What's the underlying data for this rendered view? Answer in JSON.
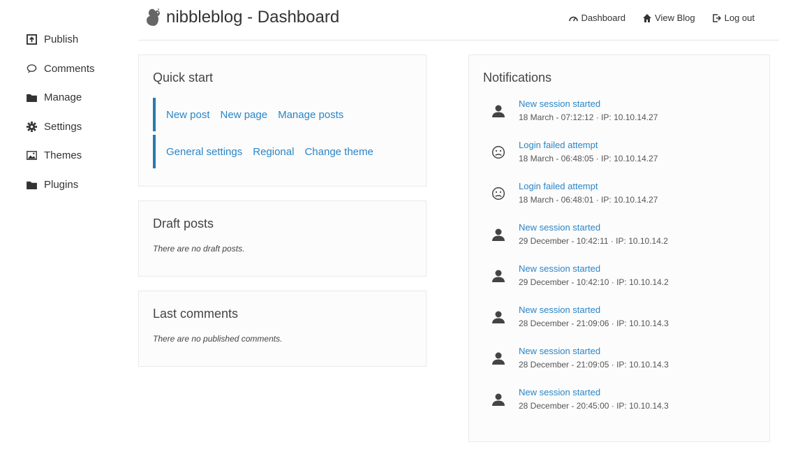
{
  "header": {
    "title": "nibbleblog - Dashboard",
    "nav": [
      {
        "label": "Dashboard",
        "icon": "dashboard-icon"
      },
      {
        "label": "View Blog",
        "icon": "home-icon"
      },
      {
        "label": "Log out",
        "icon": "logout-icon"
      }
    ]
  },
  "sidebar": {
    "items": [
      {
        "label": "Publish",
        "icon": "upload-icon"
      },
      {
        "label": "Comments",
        "icon": "comment-icon"
      },
      {
        "label": "Manage",
        "icon": "folder-icon"
      },
      {
        "label": "Settings",
        "icon": "gear-icon"
      },
      {
        "label": "Themes",
        "icon": "image-icon"
      },
      {
        "label": "Plugins",
        "icon": "folder-icon"
      }
    ]
  },
  "quick_start": {
    "title": "Quick start",
    "row1": [
      "New post",
      "New page",
      "Manage posts"
    ],
    "row2": [
      "General settings",
      "Regional",
      "Change theme"
    ]
  },
  "draft_posts": {
    "title": "Draft posts",
    "empty": "There are no draft posts."
  },
  "last_comments": {
    "title": "Last comments",
    "empty": "There are no published comments."
  },
  "notifications": {
    "title": "Notifications",
    "items": [
      {
        "title": "New session started",
        "meta": "18 March - 07:12:12 · IP: 10.10.14.27",
        "icon": "user-icon"
      },
      {
        "title": "Login failed attempt",
        "meta": "18 March - 06:48:05 · IP: 10.10.14.27",
        "icon": "sad-face-icon"
      },
      {
        "title": "Login failed attempt",
        "meta": "18 March - 06:48:01 · IP: 10.10.14.27",
        "icon": "sad-face-icon"
      },
      {
        "title": "New session started",
        "meta": "29 December - 10:42:11 · IP: 10.10.14.2",
        "icon": "user-icon"
      },
      {
        "title": "New session started",
        "meta": "29 December - 10:42:10 · IP: 10.10.14.2",
        "icon": "user-icon"
      },
      {
        "title": "New session started",
        "meta": "28 December - 21:09:06 · IP: 10.10.14.3",
        "icon": "user-icon"
      },
      {
        "title": "New session started",
        "meta": "28 December - 21:09:05 · IP: 10.10.14.3",
        "icon": "user-icon"
      },
      {
        "title": "New session started",
        "meta": "28 December - 20:45:00 · IP: 10.10.14.3",
        "icon": "user-icon"
      }
    ]
  },
  "colors": {
    "link": "#2a85c6",
    "accent_bar": "#2a7ab0"
  }
}
